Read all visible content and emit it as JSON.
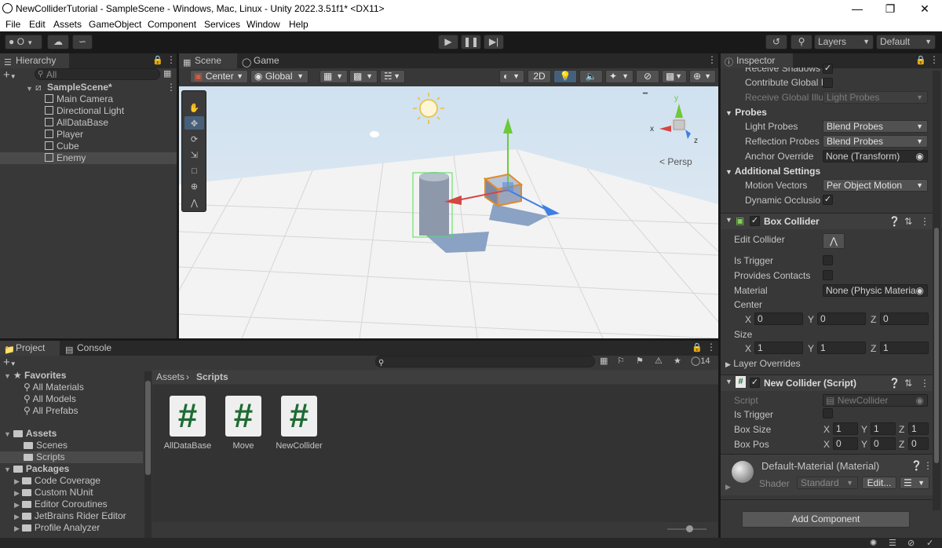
{
  "window": {
    "title": "NewColliderTutorial - SampleScene - Windows, Mac, Linux - Unity 2022.3.51f1* <DX11>"
  },
  "menu": [
    "File",
    "Edit",
    "Assets",
    "GameObject",
    "Component",
    "Services",
    "Window",
    "Help"
  ],
  "toolbar": {
    "account_badge": "O",
    "layers_label": "Layers",
    "layout_label": "Default"
  },
  "hierarchy": {
    "tab": "Hierarchy",
    "search_placeholder": "All",
    "scene": "SampleScene*",
    "items": [
      "Main Camera",
      "Directional Light",
      "AllDataBase",
      "Player",
      "Cube",
      "Enemy"
    ],
    "selected": "Enemy"
  },
  "scene_view": {
    "tabs": [
      "Scene",
      "Game"
    ],
    "pivot_mode": "Center",
    "pivot_rotation": "Global",
    "mode_2d": "2D",
    "camera_label": "Persp",
    "gizmo_axes": {
      "y": "y",
      "x": "x",
      "z": "z"
    }
  },
  "project": {
    "tabs": [
      "Project",
      "Console"
    ],
    "hidden_count": "14",
    "favorites_label": "Favorites",
    "favorites": [
      "All Materials",
      "All Models",
      "All Prefabs"
    ],
    "assets_label": "Assets",
    "assets_children": [
      "Scenes",
      "Scripts"
    ],
    "packages_label": "Packages",
    "packages": [
      "Code Coverage",
      "Custom NUnit",
      "Editor Coroutines",
      "JetBrains Rider Editor",
      "Profile Analyzer"
    ],
    "breadcrumb": [
      "Assets",
      "Scripts"
    ],
    "files": [
      "AllDataBase",
      "Move",
      "NewCollider"
    ]
  },
  "inspector": {
    "tab": "Inspector",
    "receive_shadows": "Receive Shadows",
    "contribute_gi": "Contribute Global I",
    "receive_gi": "Receive Global Illu",
    "receive_gi_value": "Light Probes",
    "probes_header": "Probes",
    "light_probes_label": "Light Probes",
    "light_probes_value": "Blend Probes",
    "reflection_probes_label": "Reflection Probes",
    "reflection_probes_value": "Blend Probes",
    "anchor_override_label": "Anchor Override",
    "anchor_override_value": "None (Transform)",
    "additional_header": "Additional Settings",
    "motion_vectors_label": "Motion Vectors",
    "motion_vectors_value": "Per Object Motion",
    "dynamic_occlusion_label": "Dynamic Occlusio",
    "box_collider": {
      "title": "Box Collider",
      "edit_collider": "Edit Collider",
      "is_trigger": "Is Trigger",
      "provides_contacts": "Provides Contacts",
      "material_label": "Material",
      "material_value": "None (Physic Materia",
      "center_label": "Center",
      "center": {
        "x": "0",
        "y": "0",
        "z": "0"
      },
      "size_label": "Size",
      "size": {
        "x": "1",
        "y": "1",
        "z": "1"
      },
      "layer_overrides": "Layer Overrides"
    },
    "script_comp": {
      "title": "New Collider (Script)",
      "script_label": "Script",
      "script_value": "NewCollider",
      "is_trigger": "Is Trigger",
      "box_size_label": "Box Size",
      "box_size": {
        "x": "1",
        "y": "1",
        "z": "1"
      },
      "box_pos_label": "Box Pos",
      "box_pos": {
        "x": "0",
        "y": "0",
        "z": "0"
      }
    },
    "material": {
      "name": "Default-Material (Material)",
      "shader_label": "Shader",
      "shader_value": "Standard",
      "edit_label": "Edit..."
    },
    "add_component": "Add Component"
  },
  "axis_letters": {
    "x": "X",
    "y": "Y",
    "z": "Z"
  }
}
